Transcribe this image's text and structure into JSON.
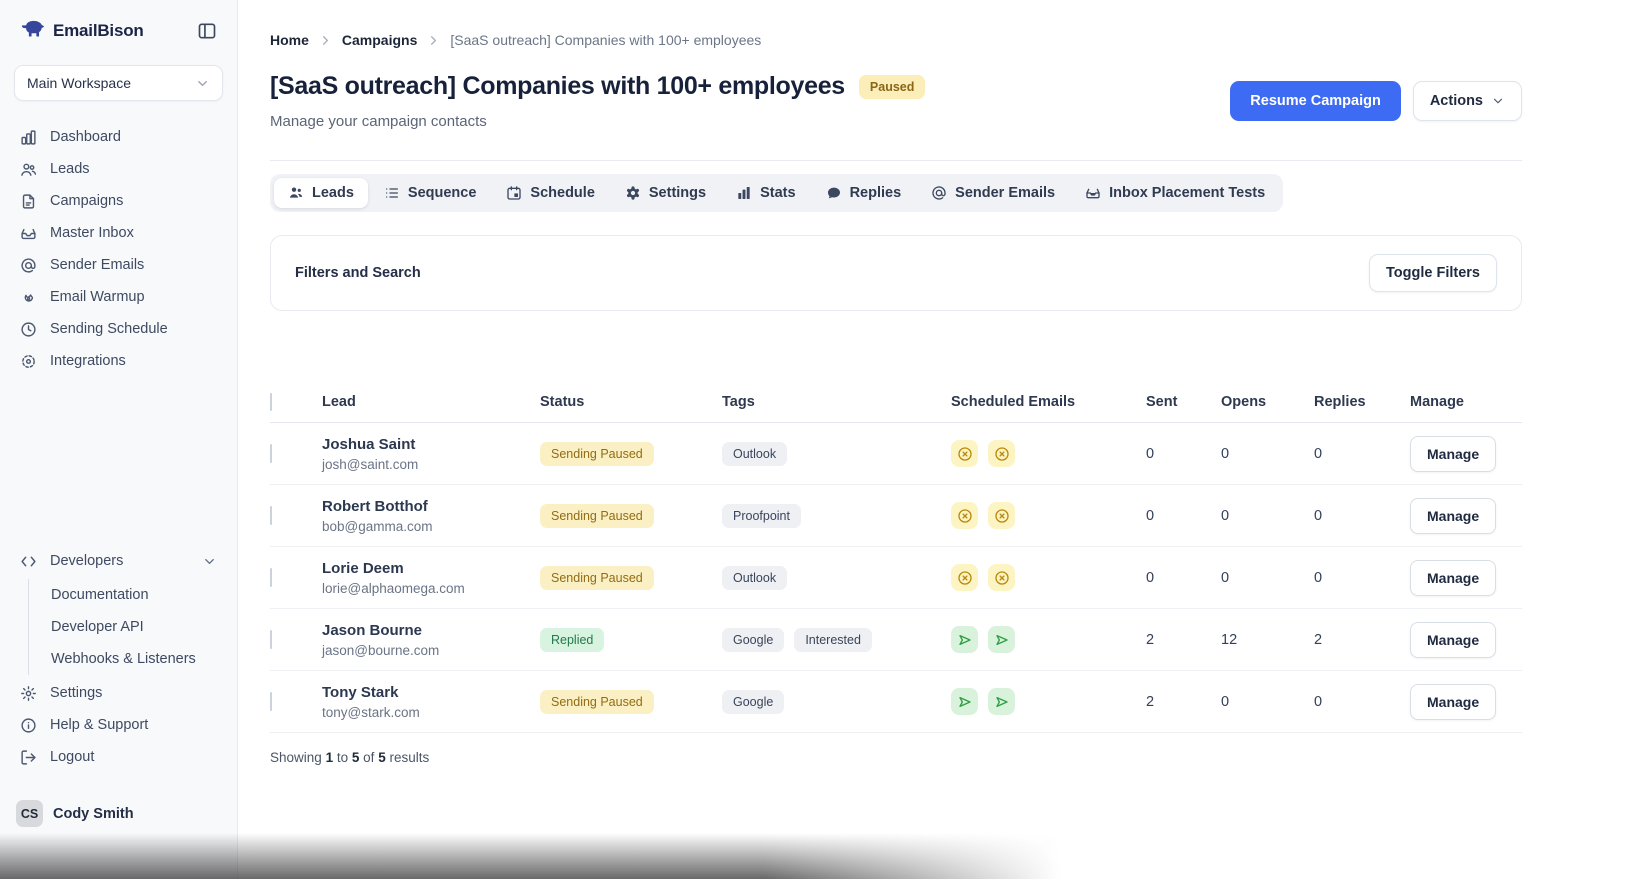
{
  "brand": {
    "name": "EmailBison"
  },
  "workspace": {
    "selected": "Main Workspace"
  },
  "sidebar": {
    "items": [
      {
        "label": "Dashboard"
      },
      {
        "label": "Leads"
      },
      {
        "label": "Campaigns"
      },
      {
        "label": "Master Inbox"
      },
      {
        "label": "Sender Emails"
      },
      {
        "label": "Email Warmup"
      },
      {
        "label": "Sending Schedule"
      },
      {
        "label": "Integrations"
      }
    ],
    "developers": {
      "label": "Developers",
      "children": [
        {
          "label": "Documentation"
        },
        {
          "label": "Developer API"
        },
        {
          "label": "Webhooks & Listeners"
        }
      ]
    },
    "footer_items": [
      {
        "label": "Settings"
      },
      {
        "label": "Help & Support"
      },
      {
        "label": "Logout"
      }
    ],
    "user": {
      "initials": "CS",
      "name": "Cody Smith"
    }
  },
  "breadcrumb": {
    "home": "Home",
    "section": "Campaigns",
    "current": "[SaaS outreach] Companies with 100+ employees"
  },
  "header": {
    "title": "[SaaS outreach] Companies with 100+ employees",
    "status_badge": "Paused",
    "subtitle": "Manage your campaign contacts",
    "resume_button": "Resume Campaign",
    "actions_button": "Actions"
  },
  "tabs": [
    {
      "label": "Leads",
      "active": true
    },
    {
      "label": "Sequence",
      "active": false
    },
    {
      "label": "Schedule",
      "active": false
    },
    {
      "label": "Settings",
      "active": false
    },
    {
      "label": "Stats",
      "active": false
    },
    {
      "label": "Replies",
      "active": false
    },
    {
      "label": "Sender Emails",
      "active": false
    },
    {
      "label": "Inbox Placement Tests",
      "active": false
    }
  ],
  "filters": {
    "title": "Filters and Search",
    "toggle_button": "Toggle Filters"
  },
  "table": {
    "columns": {
      "lead": "Lead",
      "status": "Status",
      "tags": "Tags",
      "scheduled": "Scheduled Emails",
      "sent": "Sent",
      "opens": "Opens",
      "replies": "Replies",
      "manage": "Manage"
    },
    "rows": [
      {
        "name": "Joshua Saint",
        "email": "josh@saint.com",
        "status": "Sending Paused",
        "tags": [
          "Outlook"
        ],
        "sent": "0",
        "opens": "0",
        "replies": "0",
        "manage_button": "Manage"
      },
      {
        "name": "Robert Botthof",
        "email": "bob@gamma.com",
        "status": "Sending Paused",
        "tags": [
          "Proofpoint"
        ],
        "sent": "0",
        "opens": "0",
        "replies": "0",
        "manage_button": "Manage"
      },
      {
        "name": "Lorie Deem",
        "email": "lorie@alphaomega.com",
        "status": "Sending Paused",
        "tags": [
          "Outlook"
        ],
        "sent": "0",
        "opens": "0",
        "replies": "0",
        "manage_button": "Manage"
      },
      {
        "name": "Jason Bourne",
        "email": "jason@bourne.com",
        "status": "Replied",
        "tags": [
          "Google",
          "Interested"
        ],
        "sent": "2",
        "opens": "12",
        "replies": "2",
        "manage_button": "Manage"
      },
      {
        "name": "Tony Stark",
        "email": "tony@stark.com",
        "status": "Sending Paused",
        "tags": [
          "Google"
        ],
        "sent": "2",
        "opens": "0",
        "replies": "0",
        "manage_button": "Manage"
      }
    ],
    "footer": {
      "showing": "Showing",
      "from": "1",
      "to_word": "to",
      "to": "5",
      "of_word": "of",
      "total": "5",
      "results_word": "results"
    }
  },
  "colors": {
    "accent_blue": "#3d6bf4",
    "paused_badge_bg": "#fbf0c3",
    "paused_badge_text": "#926c15",
    "replied_badge_bg": "#d8f3df",
    "replied_badge_text": "#21794a",
    "chip_yellow_bg": "#fcf5c3",
    "chip_yellow_icon": "#b9890d",
    "chip_green_bg": "#d9f2dc",
    "chip_green_icon": "#2f9e44"
  }
}
